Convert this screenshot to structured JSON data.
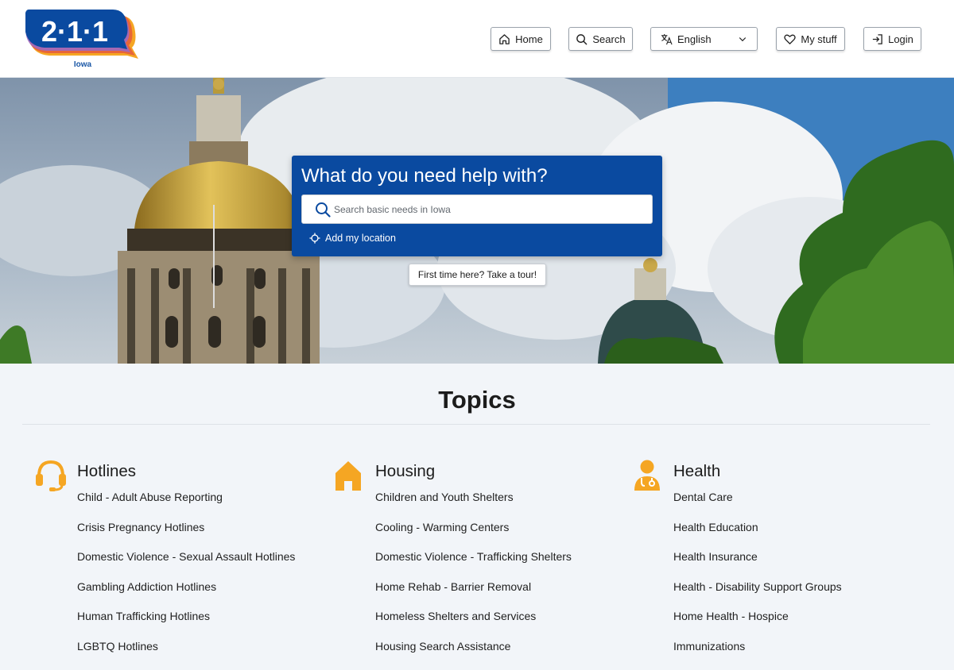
{
  "header": {
    "logo_text": "2·1·1",
    "logo_sub": "Iowa",
    "nav": [
      {
        "label": "Home",
        "icon": "home-icon"
      },
      {
        "label": "Search",
        "icon": "search-icon"
      },
      {
        "label": "English",
        "icon": "translate-icon"
      },
      {
        "label": "My stuff",
        "icon": "heart-icon"
      },
      {
        "label": "Login",
        "icon": "login-icon"
      }
    ]
  },
  "hero": {
    "title": "What do you need help with?",
    "search_placeholder": "Search basic needs in Iowa",
    "add_location": "Add my location",
    "tour_button": "First time here? Take a tour!"
  },
  "topics": {
    "title": "Topics",
    "columns": [
      {
        "heading": "Hotlines",
        "icon": "headset-icon",
        "items": [
          "Child - Adult Abuse Reporting",
          "Crisis Pregnancy Hotlines",
          "Domestic Violence - Sexual Assault Hotlines",
          "Gambling Addiction Hotlines",
          "Human Trafficking Hotlines",
          "LGBTQ Hotlines"
        ]
      },
      {
        "heading": "Housing",
        "icon": "house-icon",
        "items": [
          "Children and Youth Shelters",
          "Cooling - Warming Centers",
          "Domestic Violence - Trafficking Shelters",
          "Home Rehab - Barrier Removal",
          "Homeless Shelters and Services",
          "Housing Search Assistance"
        ]
      },
      {
        "heading": "Health",
        "icon": "doctor-icon",
        "items": [
          "Dental Care",
          "Health Education",
          "Health Insurance",
          "Health - Disability Support Groups",
          "Home Health - Hospice",
          "Immunizations"
        ]
      }
    ]
  },
  "colors": {
    "brand_blue": "#0a4aa0",
    "accent_orange": "#f5a623"
  }
}
